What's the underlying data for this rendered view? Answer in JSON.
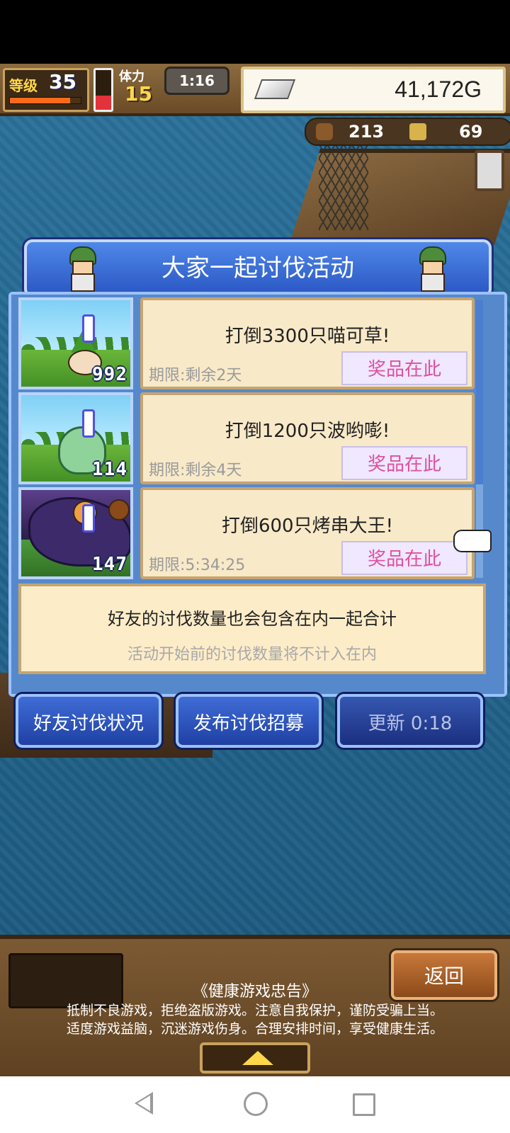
{
  "hud": {
    "level_label": "等级",
    "level": "35",
    "xp_fraction": 0.85,
    "stamina_label": "体力",
    "stamina": "15",
    "stamina_fraction": 0.35,
    "timer": "1:16",
    "gold": "41,172G",
    "resource_a": "213",
    "resource_b": "69"
  },
  "dialog": {
    "title": "大家一起讨伐活动",
    "quests": [
      {
        "title": "打倒3300只喵可草!",
        "deadline": "期限:剩余2天",
        "prize_label": "奖品在此",
        "count": "992"
      },
      {
        "title": "打倒1200只波哟嘭!",
        "deadline": "期限:剩余4天",
        "prize_label": "奖品在此",
        "count": "114"
      },
      {
        "title": "打倒600只烤串大王!",
        "deadline": "期限:5:34:25",
        "prize_label": "奖品在此",
        "count": "147"
      }
    ],
    "note_line1": "好友的讨伐数量也会包含在内一起合计",
    "note_line2": "活动开始前的讨伐数量将不计入在内"
  },
  "buttons": {
    "friend_status": "好友讨伐状况",
    "post_recruit": "发布讨伐招募",
    "refresh": "更新 0:18"
  },
  "bottom": {
    "back_label": "返回",
    "health_title": "《健康游戏忠告》",
    "health_line1": "抵制不良游戏，拒绝盗版游戏。注意自我保护，谨防受骗上当。",
    "health_line2": "适度游戏益脑，沉迷游戏伤身。合理安排时间，享受健康生活。"
  },
  "colors": {
    "title_blue": "#2a57c4",
    "prize_pink": "#e04fa0",
    "gold_yellow": "#ffd84a"
  }
}
